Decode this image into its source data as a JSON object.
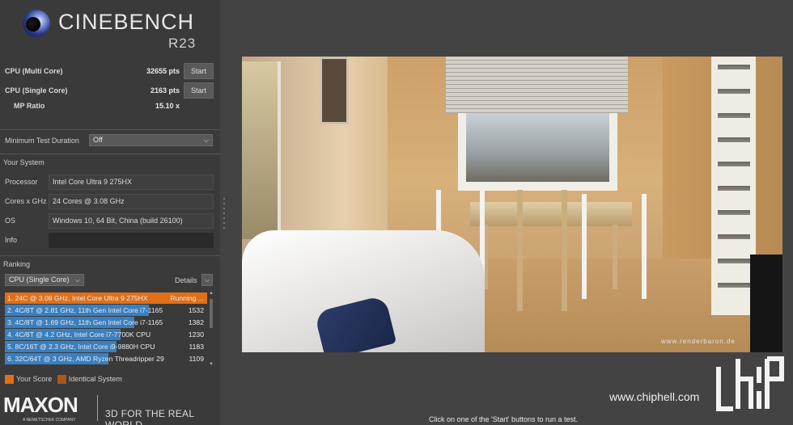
{
  "app": {
    "title": "CINEBENCH",
    "version": "R23"
  },
  "scores": [
    {
      "label": "CPU (Multi Core)",
      "value": "32655 pts",
      "button": "Start"
    },
    {
      "label": "CPU (Single Core)",
      "value": "2163 pts",
      "button": "Start"
    }
  ],
  "mp_ratio": {
    "label": "MP Ratio",
    "value": "15.10 x"
  },
  "min_test": {
    "label": "Minimum Test Duration",
    "value": "Off"
  },
  "your_system": {
    "title": "Your System",
    "rows": [
      {
        "label": "Processor",
        "value": "Intel Core Ultra 9 275HX"
      },
      {
        "label": "Cores x GHz",
        "value": "24 Cores @ 3.08 GHz"
      },
      {
        "label": "OS",
        "value": "Windows 10, 64 Bit, China (build 26100)"
      },
      {
        "label": "Info",
        "value": ""
      }
    ]
  },
  "ranking": {
    "title": "Ranking",
    "select": "CPU (Single Core)",
    "details": "Details",
    "items": [
      {
        "text": "1. 24C @ 3.08 GHz, Intel Core Ultra 9 275HX",
        "score": "Running ...",
        "fill": 1.0,
        "color": "#e07018"
      },
      {
        "text": "2. 4C/8T @ 2.81 GHz, 11th Gen Intel Core i7-1165",
        "score": "1532",
        "fill": 0.71,
        "color": "#3a7fc0"
      },
      {
        "text": "3. 4C/8T @ 1.69 GHz, 11th Gen Intel Core i7-1165",
        "score": "1382",
        "fill": 0.64,
        "color": "#3a7fc0"
      },
      {
        "text": "4. 4C/8T @ 4.2 GHz, Intel Core i7-7700K CPU",
        "score": "1230",
        "fill": 0.57,
        "color": "#3a7fc0"
      },
      {
        "text": "5. 8C/16T @ 2.3 GHz, Intel Core i9-9880H CPU",
        "score": "1183",
        "fill": 0.55,
        "color": "#3a7fc0"
      },
      {
        "text": "6. 32C/64T @ 3 GHz, AMD Ryzen Threadripper 29",
        "score": "1109",
        "fill": 0.51,
        "color": "#3a7fc0"
      }
    ],
    "legend": [
      {
        "label": "Your Score",
        "color": "#e07018"
      },
      {
        "label": "Identical System",
        "color": "#a8561a"
      }
    ]
  },
  "brand": {
    "name": "MAXON",
    "sub": "A NEMETSCHEK COMPANY",
    "tagline": "3D FOR THE REAL WORLD"
  },
  "render": {
    "watermark": "www.renderbaron.de"
  },
  "status": "Click on one of the 'Start' buttons to run a test.",
  "overlay": {
    "url": "www.chiphell.com"
  }
}
